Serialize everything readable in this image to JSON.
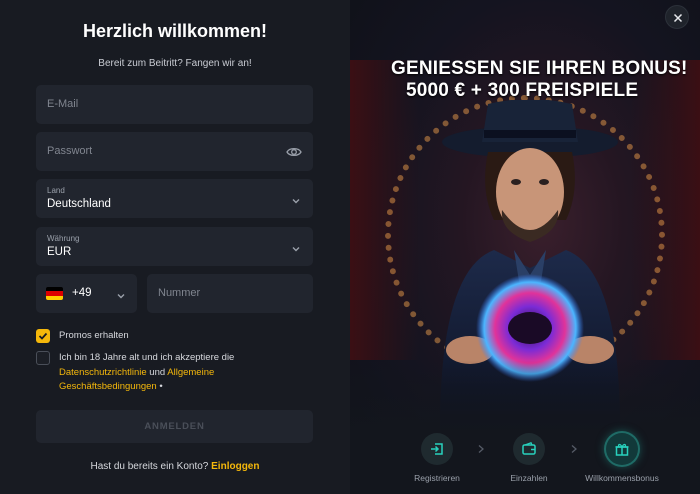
{
  "form": {
    "title": "Herzlich willkommen!",
    "subtitle": "Bereit zum Beitritt? Fangen wir an!",
    "email_placeholder": "E-Mail",
    "password_placeholder": "Passwort",
    "country_label": "Land",
    "country_value": "Deutschland",
    "currency_label": "Währung",
    "currency_value": "EUR",
    "phone_code": "+49",
    "phone_placeholder": "Nummer",
    "promos_label": "Promos erhalten",
    "terms_prefix": "Ich bin 18 Jahre alt und ich akzeptiere die",
    "terms_link1": "Datenschutzrichtlinie",
    "terms_and": " und ",
    "terms_link2": "Allgemeine",
    "terms_link2b": "Geschäftsbedingungen",
    "terms_required": " •",
    "submit_label": "ANMELDEN",
    "have_account": "Hast du bereits ein Konto?",
    "login_link": "Einloggen"
  },
  "promo": {
    "line1": "GENIESSEN SIE IHREN BONUS!",
    "line2": "5000 € + 300 FREISPIELE"
  },
  "steps": [
    {
      "label": "Registrieren",
      "icon": "login-icon"
    },
    {
      "label": "Einzahlen",
      "icon": "wallet-icon"
    },
    {
      "label": "Willkommensbonus",
      "icon": "gift-icon"
    }
  ],
  "checkbox_state": {
    "promos": true,
    "terms": false
  },
  "colors": {
    "accent": "#f5b80b",
    "step_active": "#28d2be",
    "panel": "#181b22",
    "input": "#21252e"
  }
}
